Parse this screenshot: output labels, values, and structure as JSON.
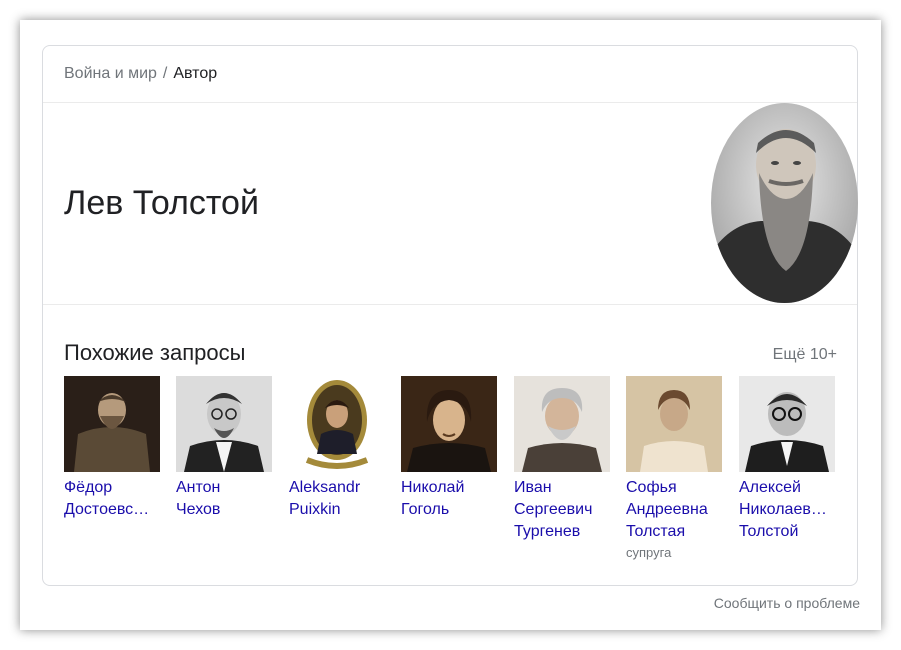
{
  "breadcrumb": {
    "parent": "Война и мир",
    "separator": "/",
    "current": "Автор"
  },
  "entity": {
    "name": "Лев Толстой"
  },
  "related": {
    "title": "Похожие запросы",
    "more": "Ещё 10+",
    "items": [
      {
        "name": "Фёдор\nДостоевс…"
      },
      {
        "name": "Антон\nЧехов"
      },
      {
        "name": "Aleksandr\nPuixkin"
      },
      {
        "name": "Николай\nГоголь"
      },
      {
        "name": "Иван\nСергеевич\nТургенев"
      },
      {
        "name": "Софья\nАндреевна\nТолстая",
        "sub": "супруга"
      },
      {
        "name": "Алексей\nНиколаев…\nТолстой"
      }
    ]
  },
  "footer": {
    "report": "Сообщить о проблеме"
  },
  "colors": {
    "link": "#1a0dab",
    "muted": "#70757a",
    "text": "#202124"
  }
}
